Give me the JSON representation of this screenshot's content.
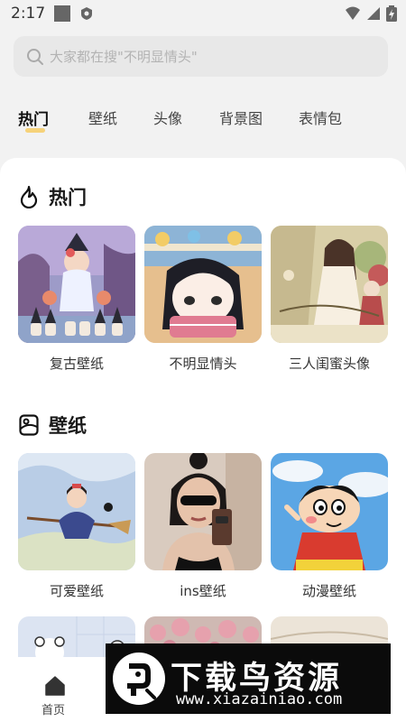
{
  "status_bar": {
    "time": "2:17"
  },
  "search": {
    "placeholder": "大家都在搜\"不明显情头\""
  },
  "tabs": [
    {
      "label": "热门"
    },
    {
      "label": "壁纸"
    },
    {
      "label": "头像"
    },
    {
      "label": "背景图"
    },
    {
      "label": "表情包"
    }
  ],
  "sections": [
    {
      "title": "热门",
      "icon": "flame-icon",
      "items": [
        {
          "label": "复古壁纸"
        },
        {
          "label": "不明显情头"
        },
        {
          "label": "三人闺蜜头像"
        }
      ]
    },
    {
      "title": "壁纸",
      "icon": "wallpaper-icon",
      "items": [
        {
          "label": "可爱壁纸"
        },
        {
          "label": "ins壁纸"
        },
        {
          "label": "动漫壁纸"
        }
      ]
    }
  ],
  "bottom_nav": {
    "home_label": "首页"
  },
  "banner": {
    "title": "下载鸟资源",
    "url": "www.xiazainiao.com"
  },
  "colors": {
    "accent": "#f6d27a",
    "background": "#f2f2f2",
    "banner_bg": "#0b0b0b"
  }
}
